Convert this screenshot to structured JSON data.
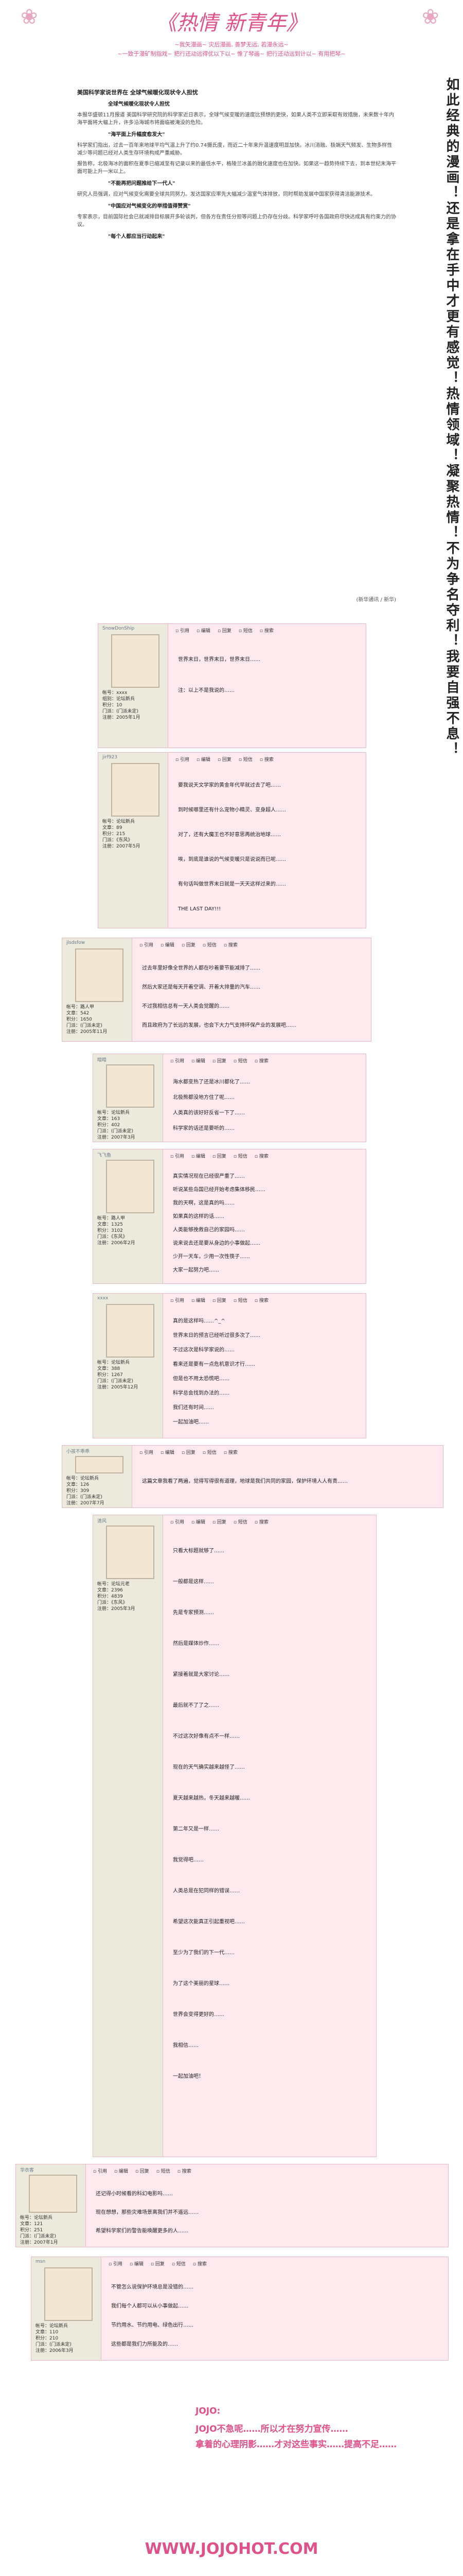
{
  "header": {
    "title": "《热情 新青年》",
    "slogan1": "~我矢漫画~ 灾后漫画, 善梦无远, 若漫永远~",
    "slogan2": "~一致于漫矿制指戏~ 把行还动远得优以下以~ 惟了琴画~ 把行还动远到计以~ 有用把琴~"
  },
  "side_text": "如此经典的漫画！还是拿在手中才更有感觉！热情领域！凝聚热情！不为争名夺利！我要自强不息！",
  "article": {
    "headline": "美国科学家说世界在 全球气候暖化现状令人担忧",
    "sub1": "全球气候暖化现状令人担忧",
    "sub2": "\"海平面上升幅度愈发大\"",
    "sub3": "\"不能再把问题推给下一代人\"",
    "sub4": "\"中国应对气候变化的举措值得赞赏\"",
    "sub5": "\"每个人都应当行动起来\"",
    "paragraphs": [
      "本报华盛顿11月报道 美国科学研究院的科学家近日表示，全球气候变暖的速度比预想的更快，如果人类不立即采取有效措施，未来数十年内海平面将大幅上升，许多沿海城市将面临被淹没的危险。",
      "科学家们指出，过去一百年来地球平均气温上升了约0.74摄氏度，而近二十年来升温速度明显加快。冰川消融、极端天气频发、生物多样性减少等问题已经对人类生存环境构成严重威胁。",
      "报告称，北极海冰的面积在夏季已缩减至有记录以来的最低水平，格陵兰冰盖的融化速度也在加快。如果这一趋势持续下去，到本世纪末海平面可能上升一米以上。",
      "研究人员强调，应对气候变化需要全球共同努力。发达国家应率先大幅减少温室气体排放，同时帮助发展中国家获得清洁能源技术。",
      "专家表示，目前国际社会已就减排目标展开多轮谈判，但各方在责任分担等问题上仍存在分歧。科学家呼吁各国政府尽快达成具有约束力的协议。"
    ],
    "source": "(新华通讯 / 新华)"
  },
  "posts": [
    {
      "name": "SnowDonShip",
      "info": [
        "帐号：xxxx",
        "组别：论坛新兵",
        "积分：10",
        "门派：(门派未定)",
        "注册：2005年1月"
      ],
      "lines": [
        "世界末日，世界末日，世界末日……",
        "注：以上不是我说的……"
      ]
    },
    {
      "name": "jirf923",
      "info": [
        "帐号：论坛新兵",
        "文章：89",
        "积分：215",
        "门派：《东风》",
        "注册：2007年5月"
      ],
      "lines": [
        "要我说天文学家的黄金年代早就过去了吧……",
        "到时候哪里还有什么宠物小精灵、变身超人……",
        "对了，还有大魔王也不好意思再统治地球……",
        "唉，到底是谁说的气候变暖只是说说而已呢……",
        "有句话叫做世界末日就是一天天这样过来的……",
        "THE LAST DAY!!!"
      ]
    },
    {
      "name": "jlsdsfow",
      "info": [
        "帐号：路人甲",
        "文章：542",
        "积分：1650",
        "门派：(门派未定)",
        "注册：2005年11月"
      ],
      "lines": [
        "过去年里好像全世界的人都在吵着要节能减排了……",
        "然后大家还是每天开着空调、开着大排量的汽车……",
        "不过我相信总有一天人类会觉醒的……",
        "而且政府为了长远的发展，也会下大力气支持环保产业的发展吧……"
      ]
    },
    {
      "name": "暗暗",
      "info": [
        "帐号：论坛新兵",
        "文章：163",
        "积分：402",
        "门派：(门派未定)",
        "注册：2007年3月"
      ],
      "lines": [
        "海水都变热了还是冰川都化了……",
        "北极熊都没地方住了呢……",
        "人类真的该好好反省一下了……",
        "科学家的话还是要听的……"
      ]
    },
    {
      "name": "飞飞鱼",
      "info": [
        "帐号：路人甲",
        "文章：1325",
        "积分：3102",
        "门派：《东风》",
        "注册：2006年2月"
      ],
      "lines": [
        "真实情况现在已经很严重了……",
        "听说某些岛国已经开始考虑集体移民……",
        "我的天啊，这是真的吗……",
        "如果真的这样的话……",
        "人类能够挽救自己的家园吗……",
        "说来说去还是要从身边的小事做起……",
        "少开一天车，少用一次性筷子……",
        "大家一起努力吧……"
      ]
    },
    {
      "name": "xxxx",
      "info": [
        "帐号：论坛新兵",
        "文章：388",
        "积分：1267",
        "门派：(门派未定)",
        "注册：2005年12月"
      ],
      "lines": [
        "真的是这样吗……^_^",
        "世界末日的预言已经听过很多次了……",
        "不过这次是科学家说的……",
        "看来还是要有一点危机意识才行……",
        "但是也不用太恐慌吧……",
        "科学总会找到办法的……",
        "我们还有时间……",
        "一起加油吧……"
      ]
    },
    {
      "name": "小孩不乖乖",
      "info": [
        "帐号：论坛新兵",
        "文章：126",
        "积分：309",
        "门派：(门派未定)",
        "注册：2007年7月"
      ],
      "lines": [
        "这篇文章我看了两遍，觉得写得很有道理，地球是我们共同的家园，保护环境人人有责……"
      ]
    },
    {
      "name": "清风",
      "info": [
        "帐号：论坛元老",
        "文章：2396",
        "积分：4839",
        "门派：《东风》",
        "注册：2005年3月"
      ],
      "lines": [
        "只看大标题就够了……",
        "一般都是这样……",
        "先是专家预测……",
        "然后是媒体炒作……",
        "紧接着就是大家讨论……",
        "最后就不了了之……",
        "不过这次好像有点不一样……",
        "现在的天气确实越来越怪了……",
        "夏天越来越热，冬天越来越暖……",
        "第二年又是一样……",
        "我觉得吧……",
        "人类总是在犯同样的错误……",
        "希望这次能真正引起重视吧……",
        "至少为了我们的下一代……",
        "为了这个美丽的星球……",
        "世界会变得更好的……",
        "我相信……",
        "一起加油吧！"
      ]
    },
    {
      "name": "华衣客",
      "info": [
        "帐号：论坛新兵",
        "文章：121",
        "积分：251",
        "门派：(门派未定)",
        "注册：2007年1月"
      ],
      "lines": [
        "还记得小时候看的科幻电影吗……",
        "现在想想，那些灾难场景离我们并不遥远……",
        "希望科学家们的警告能唤醒更多的人……"
      ]
    },
    {
      "name": "msn",
      "info": [
        "帐号：论坛新兵",
        "文章：110",
        "积分：210",
        "门派：(门派未定)",
        "注册：2006年3月"
      ],
      "lines": [
        "不管怎么说保护环境总是没错的……",
        "我们每个人都可以从小事做起……",
        "节约用水、节约用电、绿色出行……",
        "这些都是我们力所能及的……"
      ]
    }
  ],
  "toolbar": [
    "引用",
    "编辑",
    "回复",
    "短信",
    "搜索"
  ],
  "footer": {
    "line1": "JOJO:",
    "line2": "JOJO不急呢……所以才在努力宣传……",
    "line3": "拿着的心理阴影……才对这些事实……提高不足……",
    "site": "WWW.JOJOHOT.COM"
  }
}
